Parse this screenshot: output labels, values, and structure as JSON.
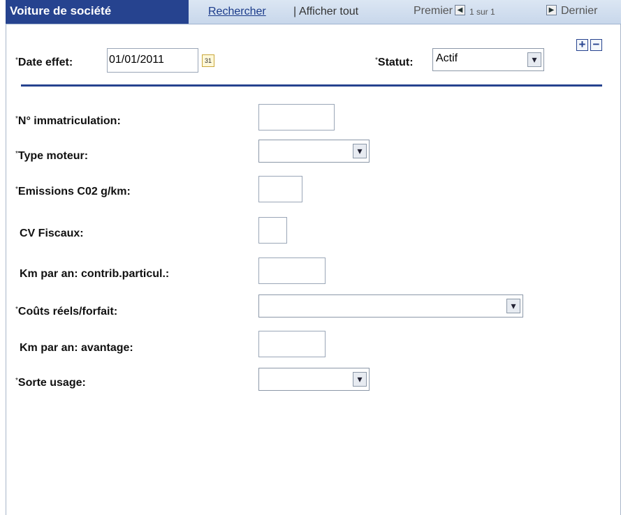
{
  "header": {
    "title": "Voiture de société",
    "search_label": "Rechercher",
    "separator": "|",
    "show_all_label": "Afficher tout",
    "first_label": "Premier",
    "counter": "1 sur 1",
    "last_label": "Dernier"
  },
  "form": {
    "required_mark": "*",
    "effective_date": {
      "label": "Date effet:",
      "value": "01/01/2011"
    },
    "status": {
      "label": "Statut:",
      "value": "Actif"
    },
    "add_label": "+",
    "remove_label": "−",
    "fields": [
      {
        "label": "N° immatriculation:",
        "value": ""
      },
      {
        "label": "Type moteur:",
        "value": ""
      },
      {
        "label": "Emissions C02 g/km:",
        "value": ""
      },
      {
        "label": "CV Fiscaux:",
        "value": ""
      },
      {
        "label": "Km par an: contrib.particul.:",
        "value": ""
      },
      {
        "label": "Coûts réels/forfait:",
        "value": ""
      },
      {
        "label": "Km par an: avantage:",
        "value": ""
      },
      {
        "label": "Sorte usage:",
        "value": ""
      }
    ]
  },
  "icons": {
    "calendar": "calendar-icon",
    "dropdown": "chevron-down-icon",
    "prev": "triangle-left-icon",
    "next": "triangle-right-icon"
  }
}
